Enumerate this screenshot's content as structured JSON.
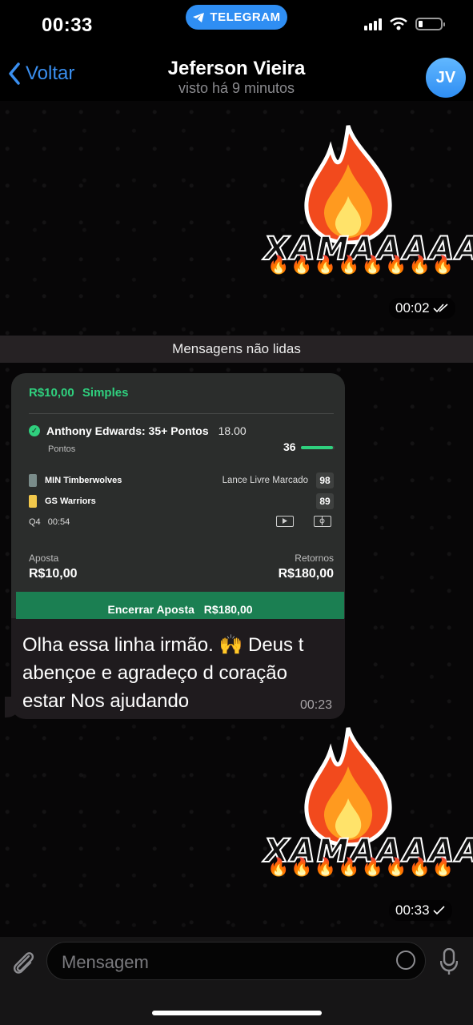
{
  "status_bar": {
    "time": "00:33",
    "app_pill": "TELEGRAM"
  },
  "header": {
    "back_label": "Voltar",
    "name": "Jeferson Vieira",
    "last_seen": "visto há 9 minutos",
    "avatar_initials": "JV"
  },
  "messages": {
    "sticker1": {
      "text": "XAMAAAAA",
      "time": "00:02"
    },
    "unread_label": "Mensagens não lidas",
    "bet": {
      "stake_head": "R$10,00",
      "bet_type": "Simples",
      "selection": "Anthony Edwards: 35+ Pontos",
      "odds": "18.00",
      "market": "Pontos",
      "progress_value": "36",
      "progress_fraction": 0.95,
      "teams": [
        {
          "name": "MIN Timberwolves",
          "market": "Lance Livre Marcado",
          "score": "98"
        },
        {
          "name": "GS Warriors",
          "market": "",
          "score": "89"
        }
      ],
      "period": "Q4",
      "clock": "00:54",
      "stake_label": "Aposta",
      "stake_value": "R$10,00",
      "returns_label": "Retornos",
      "returns_value": "R$180,00",
      "cashout_label": "Encerrar Aposta",
      "cashout_value": "R$180,00"
    },
    "caption": "Olha essa linha irmão. 🙌 Deus t abençoe e agradeço d coração estar Nos ajudando",
    "caption_time": "00:23",
    "sticker2": {
      "text": "XAMAAAAA",
      "time": "00:33"
    }
  },
  "input": {
    "placeholder": "Mensagem"
  },
  "colors": {
    "accent": "#2f8ef3",
    "bet_green": "#2fd07e",
    "cashout": "#1b7f52"
  },
  "icons": [
    "telegram-icon",
    "signal-icon",
    "wifi-icon",
    "battery-icon",
    "chevron-left-icon",
    "check-circle-icon",
    "video-icon",
    "field-icon",
    "paperclip-icon",
    "sticker-icon",
    "mic-icon",
    "fire-icon"
  ]
}
